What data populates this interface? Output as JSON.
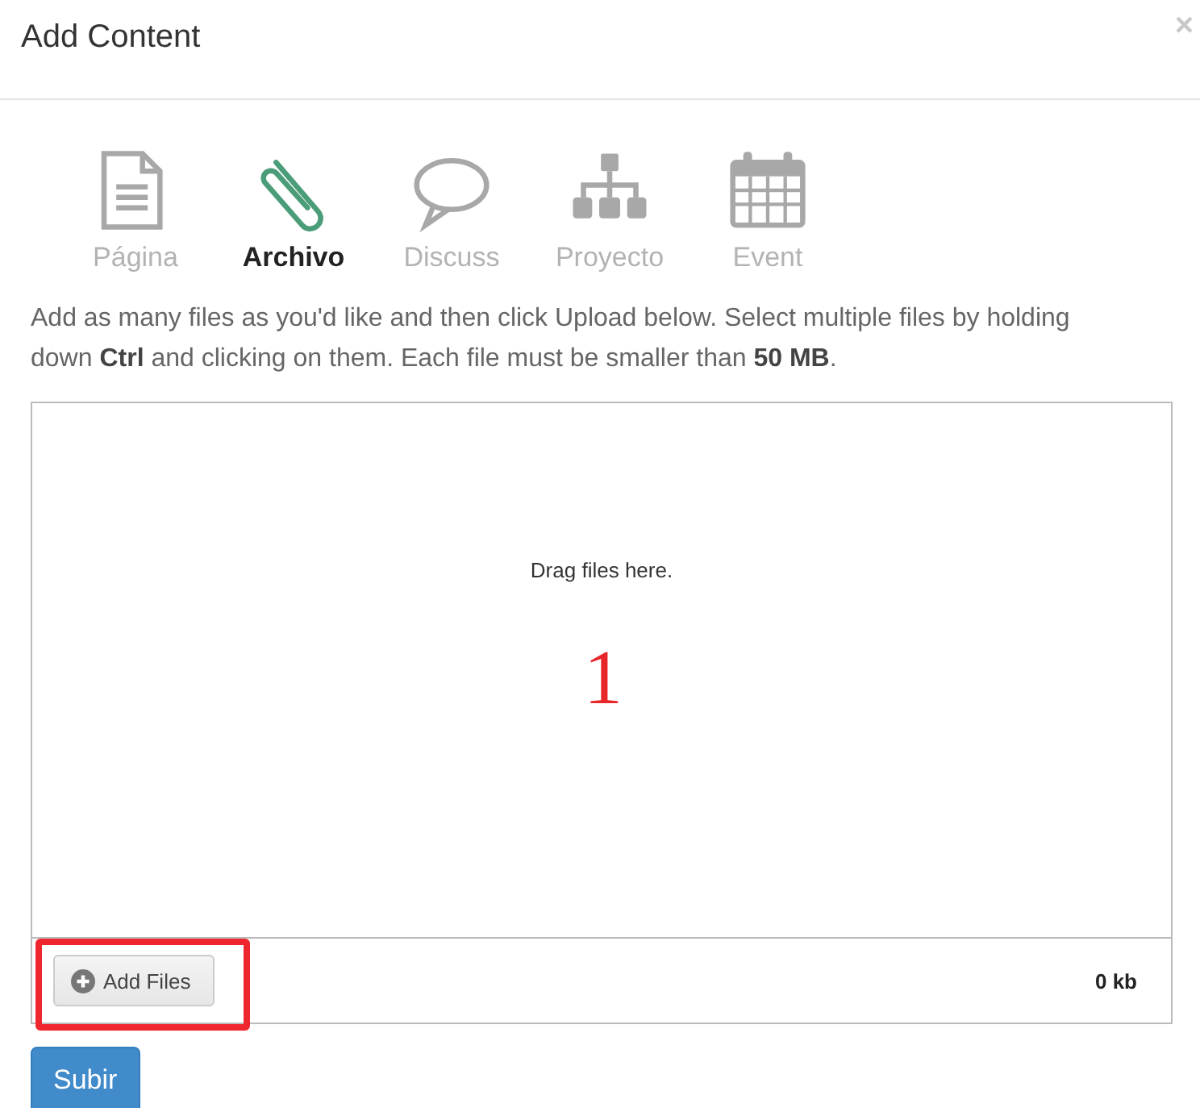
{
  "dialog": {
    "title": "Add Content",
    "close": "×"
  },
  "tabs": [
    {
      "label": "Página",
      "kind": "page",
      "selected": false
    },
    {
      "label": "Archivo",
      "kind": "clip",
      "selected": true
    },
    {
      "label": "Discuss",
      "kind": "speech",
      "selected": false
    },
    {
      "label": "Proyecto",
      "kind": "tree",
      "selected": false
    },
    {
      "label": "Event",
      "kind": "calendar",
      "selected": false
    }
  ],
  "instructions": "Add as many files as you'd like and then click Upload below. Select multiple files by holding down **Ctrl** and clicking on them. Each file must be smaller than **50 MB**.",
  "dropzone": {
    "hint": "Drag files here.",
    "add_button": "Add Files",
    "total": "0 kb"
  },
  "annotations": {
    "marker": "1",
    "add_button_highlighted": true
  },
  "submit": "Subir"
}
